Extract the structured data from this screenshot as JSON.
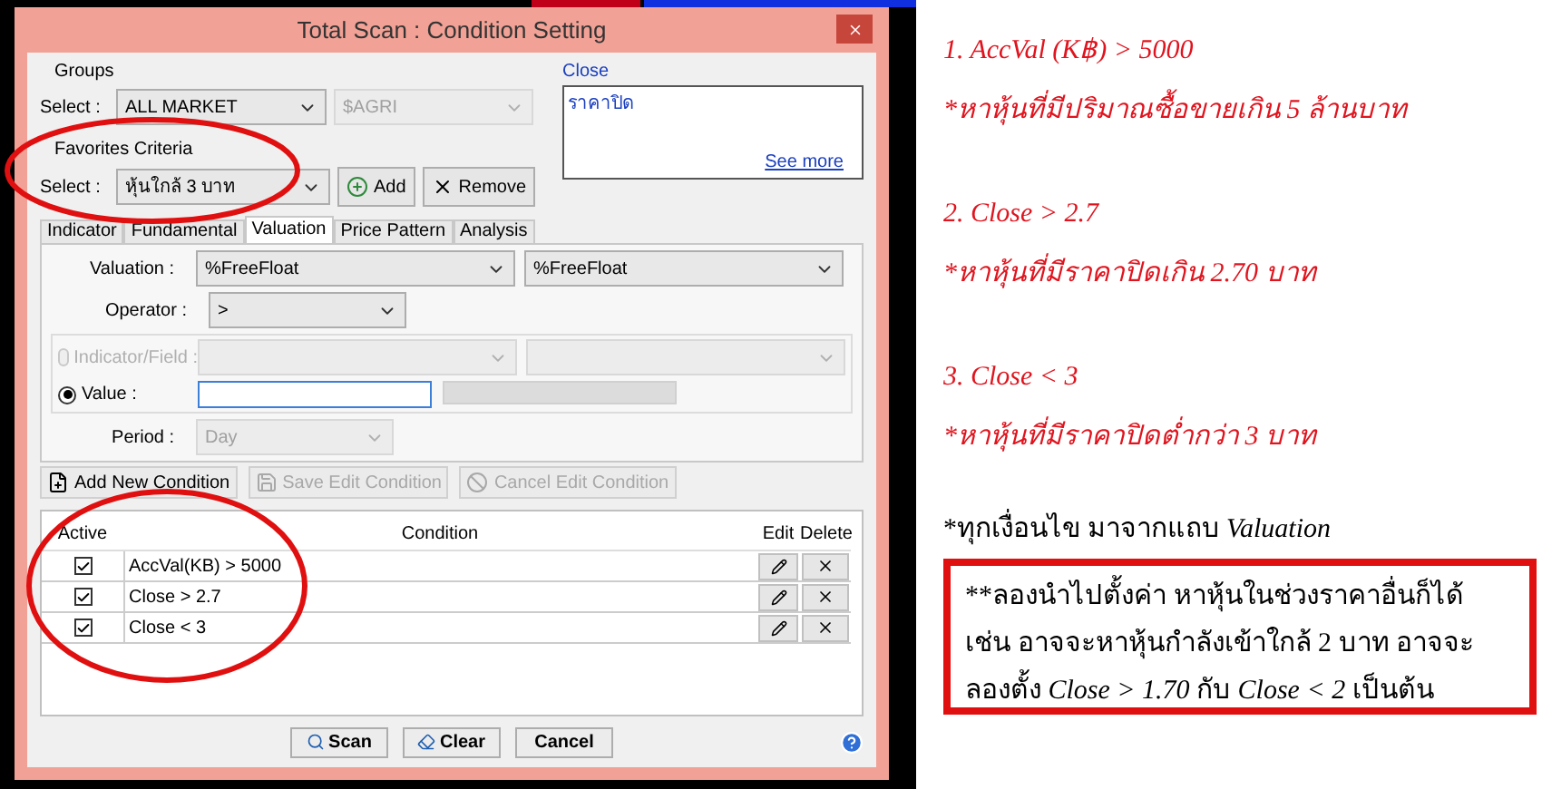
{
  "window": {
    "title": "Total Scan : Condition Setting"
  },
  "groups": {
    "label": "Groups",
    "select_label": "Select :",
    "value": "ALL MARKET",
    "sub_value": "$AGRI"
  },
  "favorites": {
    "label": "Favorites Criteria",
    "select_label": "Select :",
    "value": "หุ้นใกล้ 3 บาท",
    "add": "Add",
    "remove": "Remove"
  },
  "description": {
    "title": "Close",
    "text": "ราคาปิด",
    "link": "See more"
  },
  "tabs": [
    {
      "label": "Indicator",
      "selected": false
    },
    {
      "label": "Fundamental",
      "selected": false
    },
    {
      "label": "Valuation",
      "selected": true
    },
    {
      "label": "Price Pattern",
      "selected": false
    },
    {
      "label": "Analysis",
      "selected": false
    }
  ],
  "form": {
    "valuation_label": "Valuation :",
    "valuation_values": [
      "%FreeFloat",
      "%FreeFloat"
    ],
    "operator_label": "Operator :",
    "operator_value": ">",
    "sources": [
      {
        "label": "Indicator/Field :",
        "selected": false,
        "disabled": true
      },
      {
        "label": "Value :",
        "selected": true,
        "disabled": false
      }
    ],
    "period_label": "Period :",
    "period_value": "Day"
  },
  "condition_buttons": [
    {
      "kind": "add",
      "label": "Add New Condition",
      "disabled": false
    },
    {
      "kind": "save",
      "label": "Save Edit Condition",
      "disabled": true
    },
    {
      "kind": "cancel",
      "label": "Cancel Edit Condition",
      "disabled": true
    }
  ],
  "table": {
    "columns": [
      "Active",
      "Condition",
      "Edit",
      "Delete"
    ],
    "rows": [
      {
        "checked": true,
        "condition": "AccVal(KB) > 5000"
      },
      {
        "checked": true,
        "condition": "Close > 2.7"
      },
      {
        "checked": true,
        "condition": "Close < 3"
      }
    ]
  },
  "footer_buttons": [
    {
      "kind": "scan",
      "label": "Scan"
    },
    {
      "kind": "clear",
      "label": "Clear"
    },
    {
      "kind": "cancel",
      "label": "Cancel"
    }
  ],
  "notes": [
    {
      "heading": "1. AccVal (K฿) > 5000",
      "detail": "*หาหุ้นที่มีปริมาณซื้อขายเกิน 5 ล้านบาท"
    },
    {
      "heading": "2. Close > 2.7",
      "detail": "*หาหุ้นที่มีราคาปิดเกิน 2.70 บาท"
    },
    {
      "heading": "3. Close < 3",
      "detail": "*หาหุ้นที่มีราคาปิดต่ำกว่า 3 บาท"
    }
  ],
  "source_note": [
    {
      "text": "*ทุกเงื่อนไข มาจากแถบ ",
      "italic": false
    },
    {
      "text": "Valuation",
      "italic": true
    }
  ],
  "tip": [
    {
      "text": "**ลองนำไปตั้งค่า หาหุ้นในช่วงราคาอื่นก็ได้ เช่น อาจจะหาหุ้นกำลังเข้าใกล้ 2 บาท อาจจะลองตั้ง ",
      "italic": false
    },
    {
      "text": "Close > 1.70",
      "italic": true
    },
    {
      "text": " กับ ",
      "italic": false
    },
    {
      "text": "Close < 2",
      "italic": true
    },
    {
      "text": " เป็นต้น",
      "italic": false
    }
  ]
}
